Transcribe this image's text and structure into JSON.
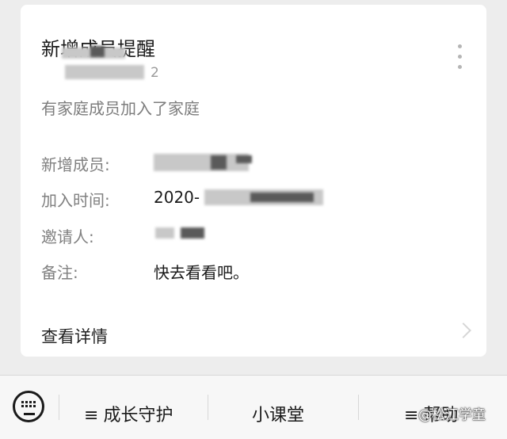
{
  "card": {
    "title": "新增成员提醒",
    "sender_suffix": "2",
    "subtitle": "有家庭成员加入了家庭",
    "rows": [
      {
        "label": "新增成员:",
        "value": ""
      },
      {
        "label": "加入时间:",
        "value": "2020-"
      },
      {
        "label": "邀请人:",
        "value": ""
      },
      {
        "label": "备注:",
        "value": "快去看看吧。"
      }
    ],
    "detail_link": "查看详情"
  },
  "bottom_bar": {
    "keyboard_icon": "keyboard-icon",
    "menus": [
      {
        "label": "成长守护",
        "has_submenu": true
      },
      {
        "label": "小课堂",
        "has_submenu": false
      },
      {
        "label": "帮助",
        "has_submenu": true
      }
    ],
    "submenu_glyph": "≡"
  },
  "watermark": "@松江学童"
}
